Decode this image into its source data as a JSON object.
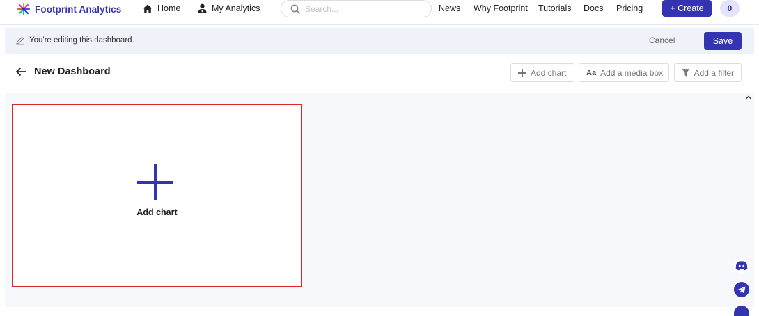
{
  "brand": {
    "name": "Footprint Analytics",
    "accent": "#3434b3",
    "logo_icon": "footprint-logo-icon"
  },
  "nav": {
    "home": "Home",
    "my_analytics": "My Analytics",
    "search_placeholder": "Search...",
    "links": [
      "News",
      "Why Footprint",
      "Tutorials",
      "Docs",
      "Pricing"
    ],
    "create_label": "+ Create",
    "count": "0"
  },
  "editbar": {
    "message": "You're editing this dashboard.",
    "cancel": "Cancel",
    "save": "Save"
  },
  "dashboard": {
    "title": "New Dashboard",
    "tools": {
      "add_chart": "Add chart",
      "add_media": "Add a media box",
      "add_filter": "Add a filter"
    },
    "card": {
      "label": "Add chart",
      "border_color": "#e0262b"
    }
  },
  "side_icons": [
    "discord-icon",
    "telegram-icon"
  ]
}
